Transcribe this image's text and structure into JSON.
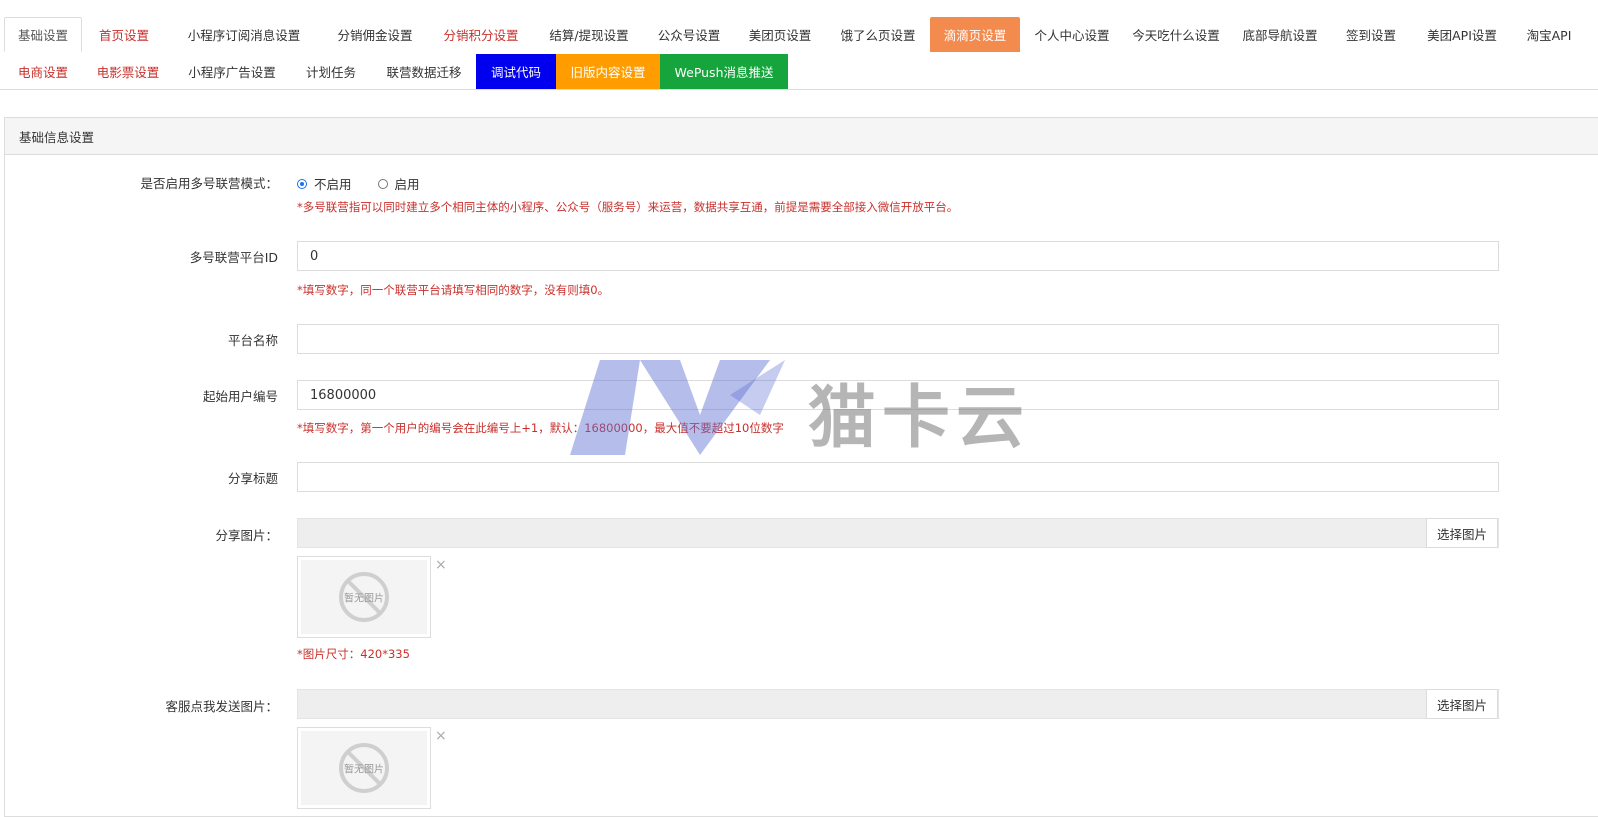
{
  "tabs_row1": [
    {
      "label": "基础设置",
      "style": "active"
    },
    {
      "label": "首页设置",
      "style": "red"
    },
    {
      "label": "小程序订阅消息设置",
      "style": ""
    },
    {
      "label": "分销佣金设置",
      "style": ""
    },
    {
      "label": "分销积分设置",
      "style": "red"
    },
    {
      "label": "结算/提现设置",
      "style": ""
    },
    {
      "label": "公众号设置",
      "style": ""
    },
    {
      "label": "美团页设置",
      "style": ""
    },
    {
      "label": "饿了么页设置",
      "style": ""
    },
    {
      "label": "滴滴页设置",
      "style": "orange-bg"
    },
    {
      "label": "个人中心设置",
      "style": ""
    },
    {
      "label": "今天吃什么设置",
      "style": ""
    },
    {
      "label": "底部导航设置",
      "style": ""
    },
    {
      "label": "签到设置",
      "style": ""
    },
    {
      "label": "美团API设置",
      "style": ""
    },
    {
      "label": "淘宝API",
      "style": ""
    }
  ],
  "tabs_row2": [
    {
      "label": "电商设置",
      "style": "red"
    },
    {
      "label": "电影票设置",
      "style": "red"
    },
    {
      "label": "小程序广告设置",
      "style": ""
    },
    {
      "label": "计划任务",
      "style": ""
    },
    {
      "label": "联营数据迁移",
      "style": ""
    },
    {
      "label": "调试代码",
      "style": "blue-bg"
    },
    {
      "label": "旧版内容设置",
      "style": "yellow-bg"
    },
    {
      "label": "WePush消息推送",
      "style": "green-bg"
    }
  ],
  "panel": {
    "title": "基础信息设置"
  },
  "form": {
    "multi_mode": {
      "label": "是否启用多号联营模式：",
      "options": [
        "不启用",
        "启用"
      ],
      "selected": "不启用",
      "hint": "*多号联营指可以同时建立多个相同主体的小程序、公众号（服务号）来运营，数据共享互通，前提是需要全部接入微信开放平台。"
    },
    "platform_id": {
      "label": "多号联营平台ID",
      "value": "0",
      "hint": "*填写数字，同一个联营平台请填写相同的数字，没有则填0。"
    },
    "platform_name": {
      "label": "平台名称",
      "value": ""
    },
    "start_user_no": {
      "label": "起始用户编号",
      "value": "16800000",
      "hint": "*填写数字，第一个用户的编号会在此编号上+1，默认：16800000，最大值不要超过10位数字"
    },
    "share_title": {
      "label": "分享标题",
      "value": ""
    },
    "share_image": {
      "label": "分享图片：",
      "button": "选择图片",
      "placeholder_text": "暂无图片",
      "hint": "*图片尺寸：420*335"
    },
    "service_image": {
      "label": "客服点我发送图片：",
      "button": "选择图片",
      "placeholder_text": "暂无图片"
    }
  },
  "watermark": {
    "logo_letters": "MK",
    "text": "猫卡云"
  },
  "colors": {
    "red": "#c9302c",
    "orange": "#f38a4e",
    "blue": "#0000ee",
    "yellow": "#ff9d00",
    "green": "#16a53c",
    "radio": "#1a73e8"
  }
}
